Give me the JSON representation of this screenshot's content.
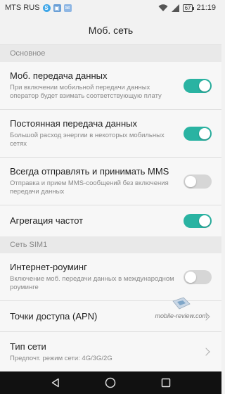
{
  "status_bar": {
    "carrier": "MTS RUS",
    "battery": "67",
    "time": "21:19",
    "icons": [
      "skype-icon",
      "gallery-icon",
      "chat-icon",
      "wifi-icon",
      "signal-icon",
      "battery-icon"
    ]
  },
  "header": {
    "title": "Моб. сеть"
  },
  "sections": [
    {
      "title": "Основное",
      "items": [
        {
          "title": "Моб. передача данных",
          "subtitle": "При включении мобильной передачи данных оператор будет взимать соответствующую плату",
          "control": "toggle",
          "on": true
        },
        {
          "title": "Постоянная передача данных",
          "subtitle": "Большой расход энергии в некоторых мобильных сетях",
          "control": "toggle",
          "on": true
        },
        {
          "title": "Всегда отправлять и принимать MMS",
          "subtitle": "Отправка и прием MMS-сообщений без включения передачи данных",
          "control": "toggle",
          "on": false
        },
        {
          "title": "Агрегация частот",
          "subtitle": "",
          "control": "toggle",
          "on": true
        }
      ]
    },
    {
      "title": "Сеть SIM1",
      "items": [
        {
          "title": "Интернет-роуминг",
          "subtitle": "Включение моб. передачи данных в международном роуминге",
          "control": "toggle",
          "on": false
        },
        {
          "title": "Точки доступа (APN)",
          "subtitle": "",
          "control": "chevron"
        },
        {
          "title": "Тип сети",
          "subtitle": "Предпочт. режим сети: 4G/3G/2G",
          "control": "chevron"
        }
      ]
    }
  ],
  "watermark": {
    "text": "mobile-review.com"
  },
  "colors": {
    "toggle_on": "#2ab3a2",
    "toggle_off": "#d6d6d6",
    "background": "#f2f2f2",
    "navbar": "#111111"
  }
}
